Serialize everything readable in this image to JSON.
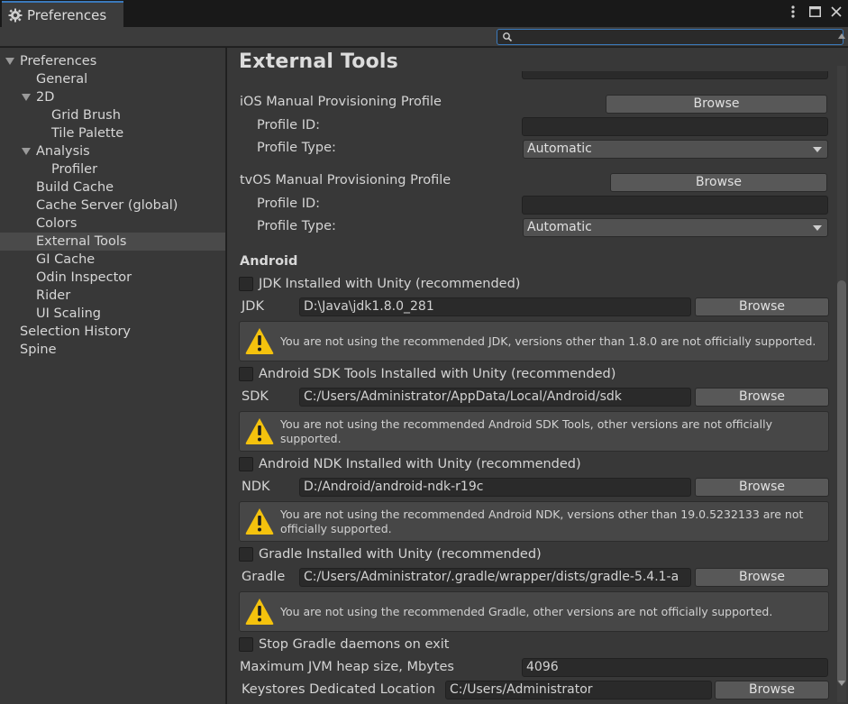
{
  "window": {
    "tab_title": "Preferences",
    "tab_icon": "gear-icon",
    "controls": [
      "more-options-icon",
      "maximize-icon",
      "close-icon"
    ]
  },
  "search": {
    "placeholder": "",
    "value": ""
  },
  "sidebar": {
    "items": [
      {
        "label": "Preferences",
        "level": 0,
        "expanded": true,
        "selected": false
      },
      {
        "label": "General",
        "level": 1,
        "expanded": null,
        "selected": false
      },
      {
        "label": "2D",
        "level": 1,
        "expanded": true,
        "selected": false
      },
      {
        "label": "Grid Brush",
        "level": 2,
        "expanded": null,
        "selected": false
      },
      {
        "label": "Tile Palette",
        "level": 2,
        "expanded": null,
        "selected": false
      },
      {
        "label": "Analysis",
        "level": 1,
        "expanded": true,
        "selected": false
      },
      {
        "label": "Profiler",
        "level": 2,
        "expanded": null,
        "selected": false
      },
      {
        "label": "Build Cache",
        "level": 1,
        "expanded": null,
        "selected": false
      },
      {
        "label": "Cache Server (global)",
        "level": 1,
        "expanded": null,
        "selected": false
      },
      {
        "label": "Colors",
        "level": 1,
        "expanded": null,
        "selected": false
      },
      {
        "label": "External Tools",
        "level": 1,
        "expanded": null,
        "selected": true
      },
      {
        "label": "GI Cache",
        "level": 1,
        "expanded": null,
        "selected": false
      },
      {
        "label": "Odin Inspector",
        "level": 1,
        "expanded": null,
        "selected": false
      },
      {
        "label": "Rider",
        "level": 1,
        "expanded": null,
        "selected": false
      },
      {
        "label": "UI Scaling",
        "level": 1,
        "expanded": null,
        "selected": false
      },
      {
        "label": "Selection History",
        "level": 0,
        "expanded": null,
        "selected": false
      },
      {
        "label": "Spine",
        "level": 0,
        "expanded": null,
        "selected": false
      }
    ]
  },
  "main": {
    "title": "External Tools",
    "ios": {
      "label": "iOS Manual Provisioning Profile",
      "browse": "Browse",
      "profile_id_label": "Profile ID:",
      "profile_id_value": "",
      "profile_type_label": "Profile Type:",
      "profile_type_value": "Automatic"
    },
    "tvos": {
      "label": "tvOS Manual Provisioning Profile",
      "browse": "Browse",
      "profile_id_label": "Profile ID:",
      "profile_id_value": "",
      "profile_type_label": "Profile Type:",
      "profile_type_value": "Automatic"
    },
    "android": {
      "header": "Android",
      "jdk": {
        "checkbox_label": "JDK Installed with Unity (recommended)",
        "checked": false,
        "field_label": "JDK",
        "path": "D:\\Java\\jdk1.8.0_281",
        "browse": "Browse",
        "warning_line1": "You are not using the recommended JDK, versions other than 1.8.0 are not officially supported.",
        "warning_line2": ""
      },
      "sdk": {
        "checkbox_label": "Android SDK Tools Installed with Unity (recommended)",
        "checked": false,
        "field_label": "SDK",
        "path": "C:/Users/Administrator/AppData/Local/Android/sdk",
        "browse": "Browse",
        "warning_line1": "You are not using the recommended Android SDK Tools, other versions are not officially",
        "warning_line2": "supported."
      },
      "ndk": {
        "checkbox_label": "Android NDK Installed with Unity (recommended)",
        "checked": false,
        "field_label": "NDK",
        "path": "D:/Android/android-ndk-r19c",
        "browse": "Browse",
        "warning_line1": "You are not using the recommended Android NDK, versions other than 19.0.5232133 are not",
        "warning_line2": "officially supported."
      },
      "gradle": {
        "checkbox_label": "Gradle Installed with Unity (recommended)",
        "checked": false,
        "field_label": "Gradle",
        "path": "C:/Users/Administrator/.gradle/wrapper/dists/gradle-5.4.1-a",
        "browse": "Browse",
        "warning_line1": "You are not using the recommended Gradle, other versions are not officially supported.",
        "warning_line2": ""
      },
      "stop_gradle": {
        "label": "Stop Gradle daemons on exit",
        "checked": false
      },
      "jvm_heap": {
        "label": "Maximum JVM heap size, Mbytes",
        "value": "4096"
      },
      "keystores": {
        "label": "Keystores Dedicated Location",
        "value": "C:/Users/Administrator",
        "browse": "Browse"
      }
    }
  },
  "colors": {
    "accent": "#3a79bb",
    "panel": "#383838",
    "selected_row": "#4a4a4a",
    "warning_icon": "#f4c20d"
  }
}
